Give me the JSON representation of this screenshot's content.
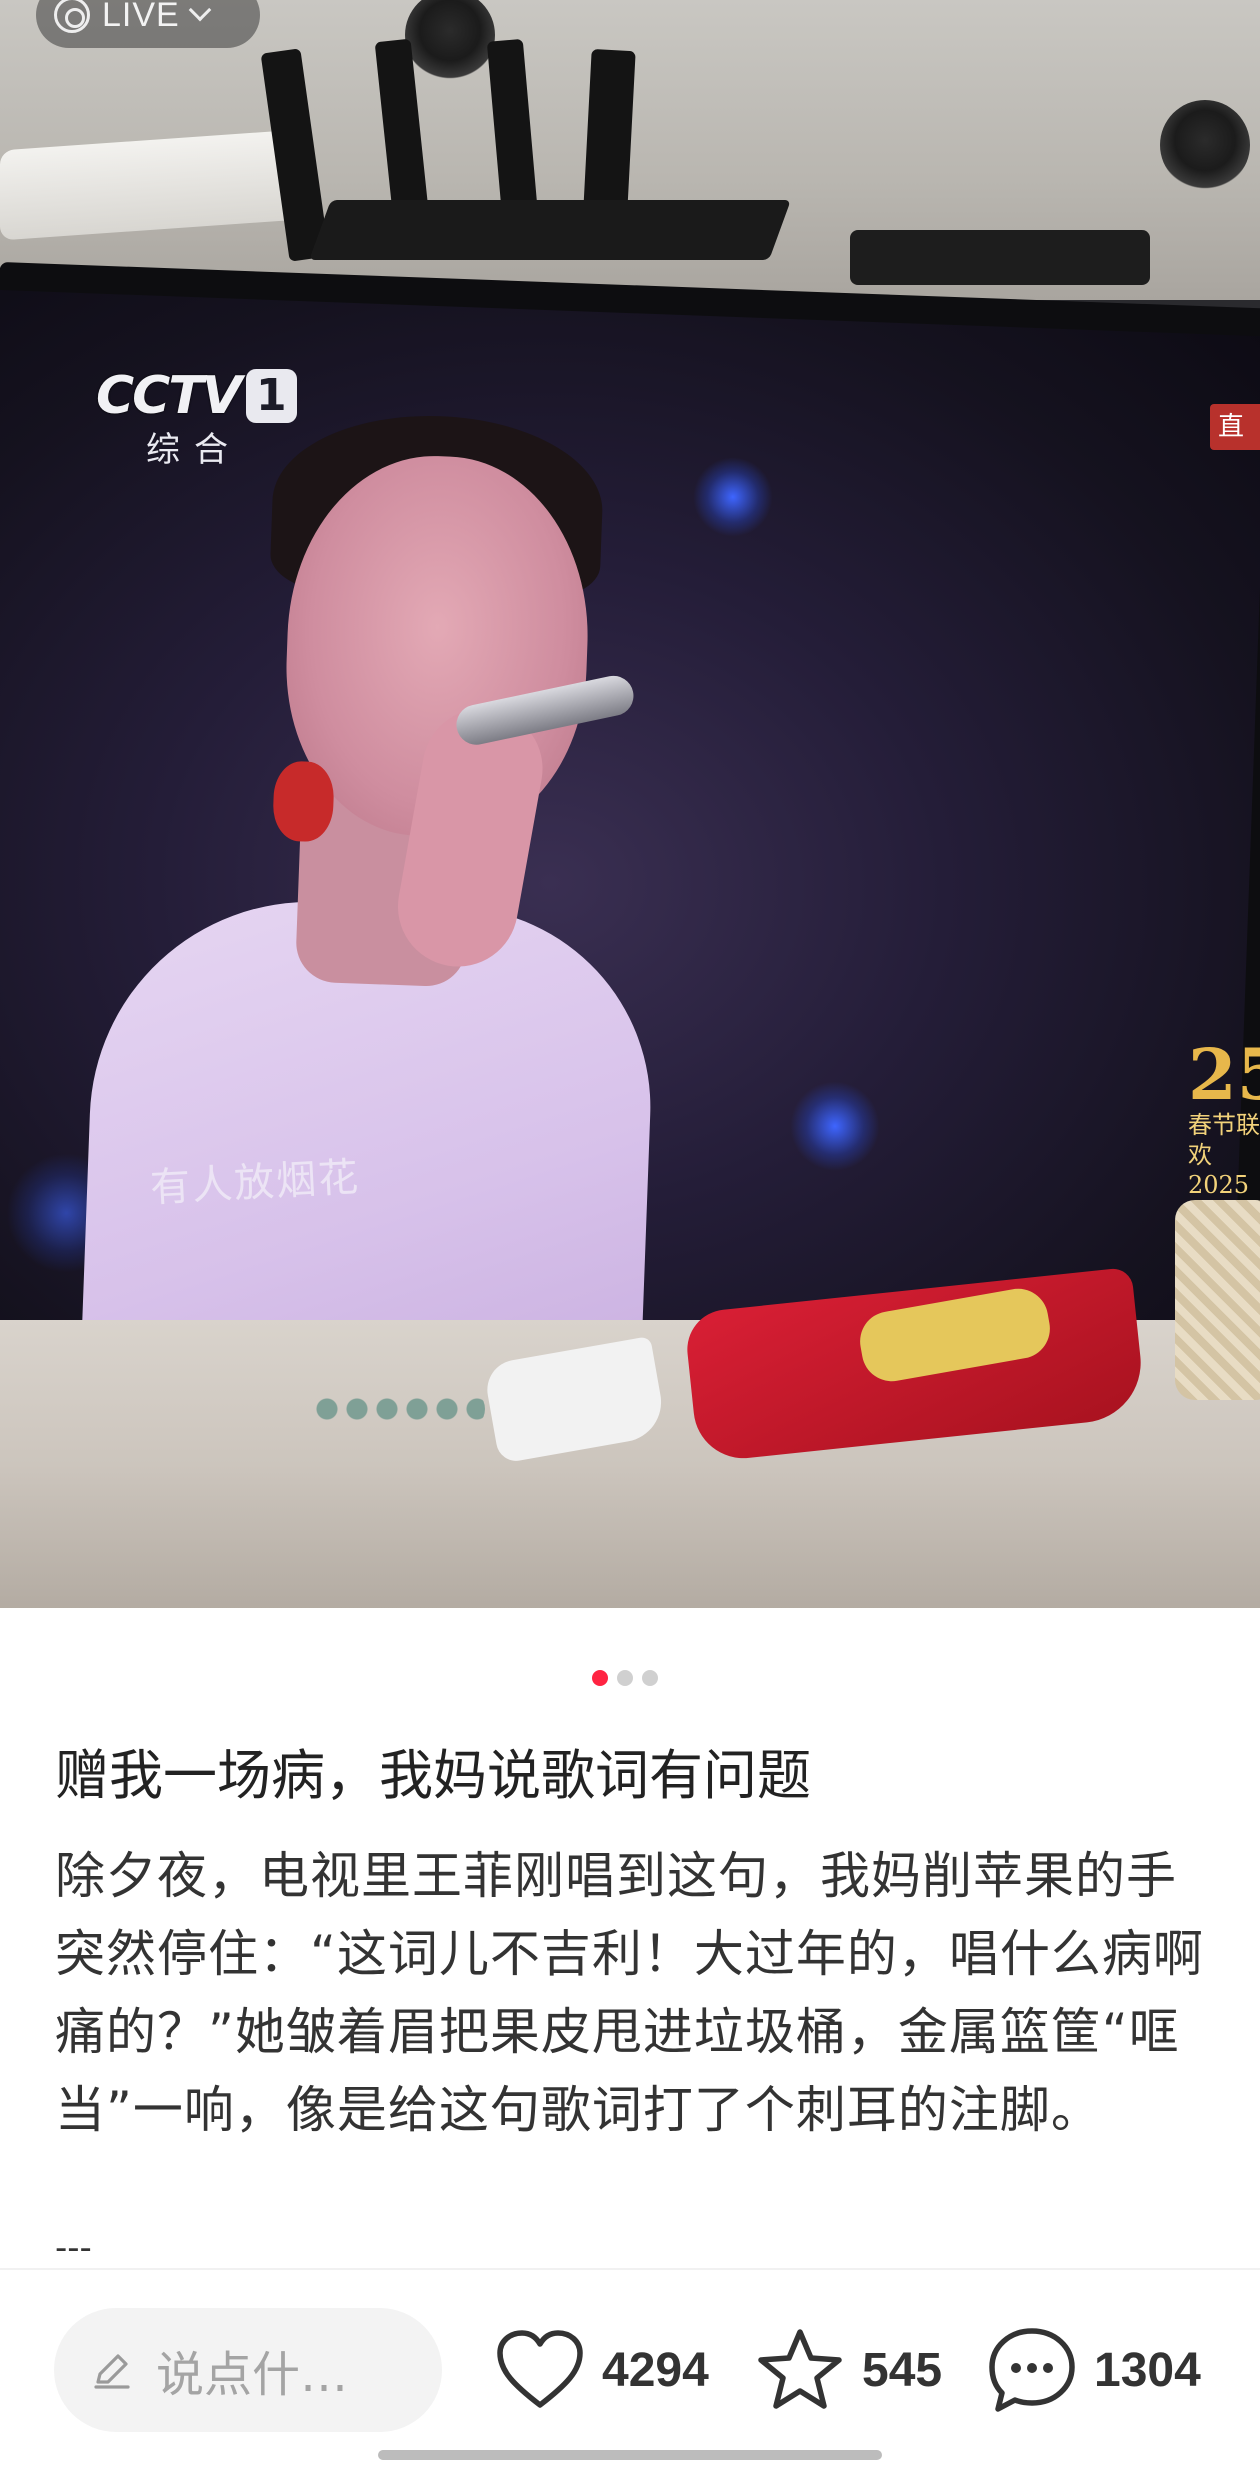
{
  "photo": {
    "live_label": "LIVE",
    "channel_logo": "CCTV",
    "channel_number": "1",
    "channel_name": "综合",
    "tv_subtitle": "有人放烟花",
    "gala_badge_top": "春节联欢",
    "gala_badge_year": "2025",
    "tv_live_tag": "直"
  },
  "pager": {
    "total": 3,
    "active_index": 0
  },
  "post": {
    "title": "赠我一场病，我妈说歌词有问题",
    "body": "除夕夜，电视里王菲刚唱到这句，我妈削苹果的手突然停住：“这词儿不吉利！大过年的，唱什么病啊痛的？”她皱着眉把果皮甩进垃圾桶，金属篮筐“哐当”一响，像是给这句歌词打了个刺耳的注脚。",
    "separator": "---"
  },
  "bottom_bar": {
    "comment_placeholder": "说点什…",
    "like_count": "4294",
    "collect_count": "545",
    "comment_count": "1304"
  },
  "icons": {
    "live": "live-photo-icon",
    "pencil": "pencil-icon",
    "like": "heart-icon",
    "collect": "star-icon",
    "comment": "chat-bubble-icon"
  },
  "colors": {
    "accent": "#ff2442",
    "text_primary": "#222222",
    "placeholder": "#a4a4a4"
  }
}
